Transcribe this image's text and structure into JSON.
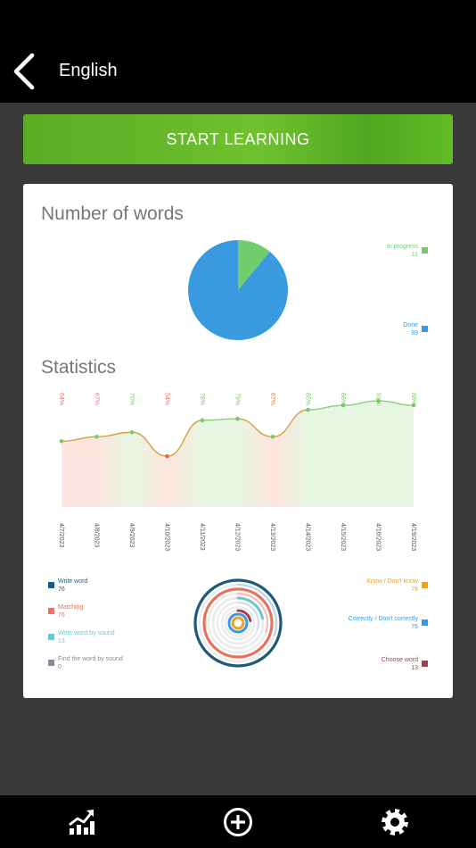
{
  "header": {
    "title": "English"
  },
  "start_button": {
    "label": "START LEARNING"
  },
  "words_section": {
    "title": "Number of words",
    "legend": [
      {
        "label": "In progress",
        "value": "11",
        "color": "#6fcf6f"
      },
      {
        "label": "Done",
        "value": "89",
        "color": "#3a9ae0"
      }
    ]
  },
  "statistics_section": {
    "title": "Statistics",
    "percent_labels": [
      "64%",
      "67%",
      "70%",
      "54%",
      "78%",
      "79%",
      "67%",
      "85%",
      "88%",
      "91%",
      "88%"
    ],
    "date_labels": [
      "4/7/2023",
      "4/8/2023",
      "4/9/2023",
      "4/10/2023",
      "4/11/2023",
      "4/12/2023",
      "4/13/2023",
      "4/14/2023",
      "4/15/2023",
      "4/16/2023",
      "4/19/2023"
    ]
  },
  "ring_legend": {
    "left": [
      {
        "label": "Write word",
        "value": "76",
        "color": "#1f5a7a"
      },
      {
        "label": "Matching",
        "value": "76",
        "color": "#e8735a"
      },
      {
        "label": "Write word by sound",
        "value": "13",
        "color": "#6fc6cf"
      },
      {
        "label": "Find the word by sound",
        "value": "0",
        "color": "#8a8a9a"
      }
    ],
    "right": [
      {
        "label": "Know / Don't know",
        "value": "76",
        "color": "#f0a020"
      },
      {
        "label": "Correctly / Don't correctly",
        "value": "76",
        "color": "#3a9ae0"
      },
      {
        "label": "Choose word",
        "value": "13",
        "color": "#a04050"
      }
    ]
  },
  "chart_data": [
    {
      "type": "pie",
      "title": "Number of words",
      "categories": [
        "In progress",
        "Done"
      ],
      "values": [
        11,
        89
      ],
      "colors": [
        "#6fcf6f",
        "#3a9ae0"
      ],
      "legend": "right"
    },
    {
      "type": "area",
      "title": "Statistics",
      "x": [
        "4/7/2023",
        "4/8/2023",
        "4/9/2023",
        "4/10/2023",
        "4/11/2023",
        "4/12/2023",
        "4/13/2023",
        "4/14/2023",
        "4/15/2023",
        "4/16/2023",
        "4/19/2023"
      ],
      "values": [
        64,
        67,
        70,
        54,
        78,
        79,
        67,
        85,
        88,
        91,
        88
      ],
      "ylim": [
        0,
        100
      ],
      "grid": false
    },
    {
      "type": "radial-bar",
      "series": [
        {
          "name": "Write word",
          "value": 76
        },
        {
          "name": "Matching",
          "value": 76
        },
        {
          "name": "Write word by sound",
          "value": 13
        },
        {
          "name": "Find the word by sound",
          "value": 0
        },
        {
          "name": "Know / Don't know",
          "value": 76
        },
        {
          "name": "Correctly / Don't correctly",
          "value": 76
        },
        {
          "name": "Choose word",
          "value": 13
        }
      ],
      "max": 76
    }
  ]
}
